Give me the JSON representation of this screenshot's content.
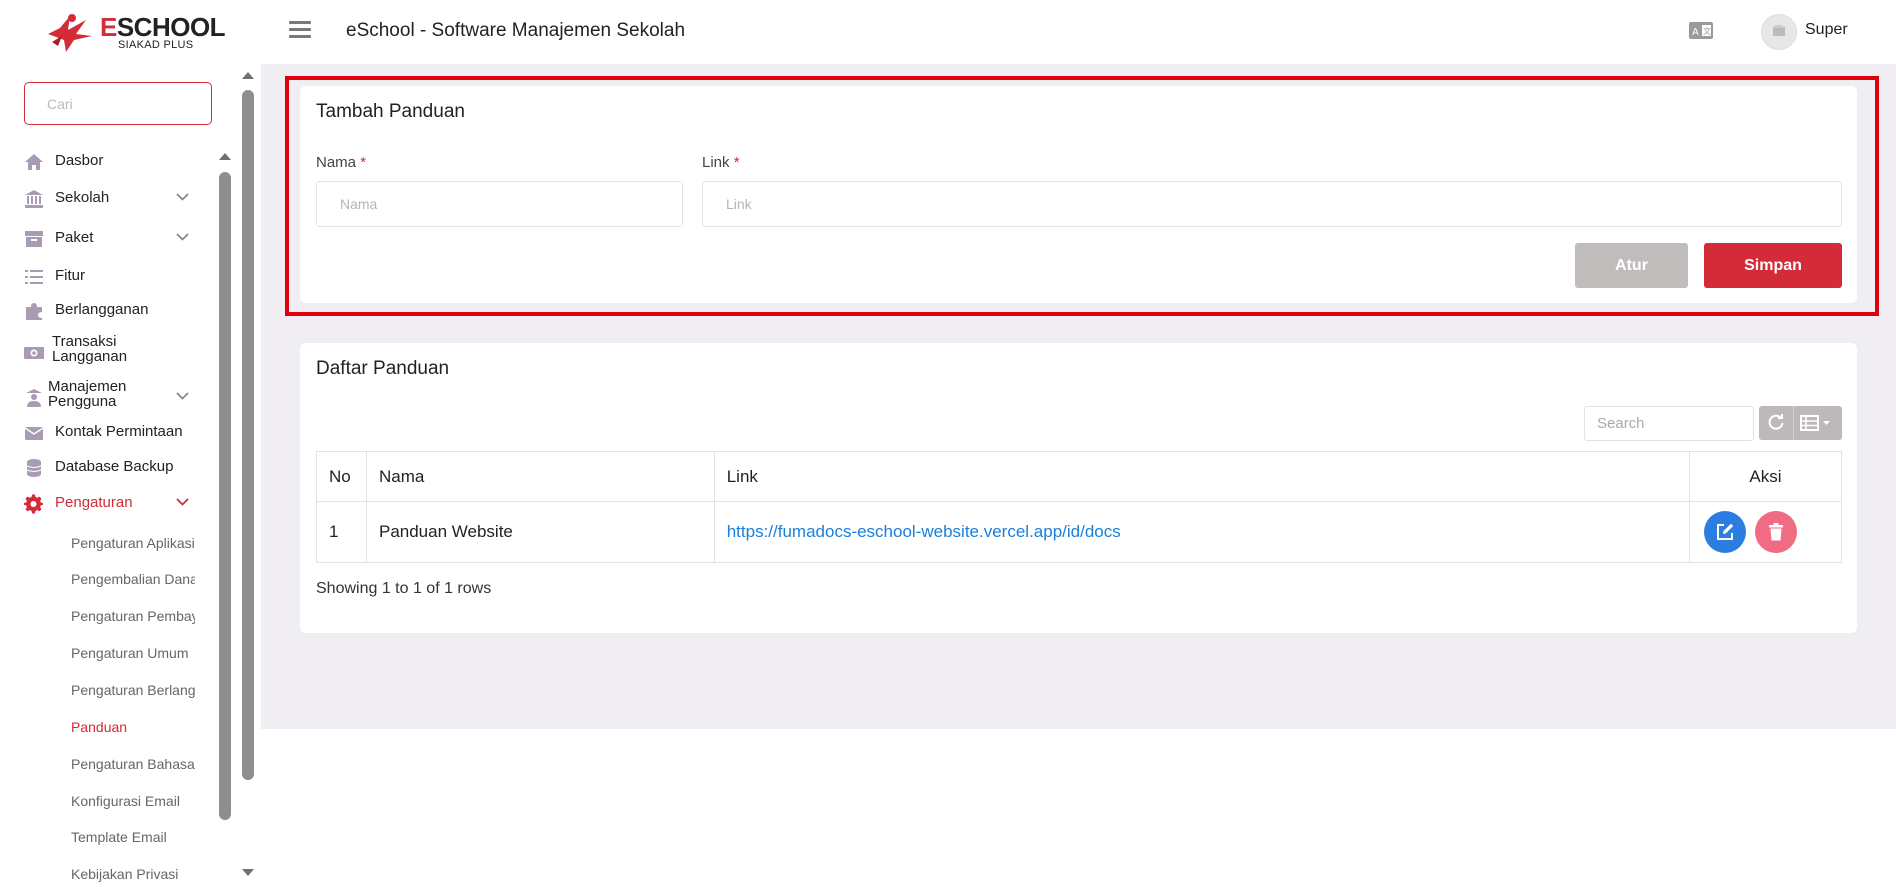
{
  "brand": {
    "name_first": "E",
    "name_rest": "SCHOOL",
    "subtitle": "SIAKAD PLUS"
  },
  "header": {
    "title": "eSchool - Software Manajemen Sekolah",
    "user": "Super"
  },
  "sidebar": {
    "search_placeholder": "Cari",
    "items": [
      {
        "label": "Dasbor",
        "icon": "home-icon"
      },
      {
        "label": "Sekolah",
        "icon": "bank-icon",
        "expandable": true
      },
      {
        "label": "Paket",
        "icon": "archive-icon",
        "expandable": true
      },
      {
        "label": "Fitur",
        "icon": "list-icon"
      },
      {
        "label": "Berlangganan",
        "icon": "puzzle-icon"
      },
      {
        "label": "Transaksi Langganan",
        "icon": "money-icon"
      },
      {
        "label": "Manajemen Pengguna",
        "icon": "users-icon",
        "expandable": true
      },
      {
        "label": "Kontak Permintaan",
        "icon": "envelope-icon"
      },
      {
        "label": "Database Backup",
        "icon": "database-icon"
      },
      {
        "label": "Pengaturan",
        "icon": "gear-icon",
        "expandable": true,
        "active": true
      }
    ],
    "subitems": [
      {
        "label": "Pengaturan Aplikasi"
      },
      {
        "label": "Pengembalian Dana"
      },
      {
        "label": "Pengaturan Pembayaran"
      },
      {
        "label": "Pengaturan Umum"
      },
      {
        "label": "Pengaturan Berlangganan"
      },
      {
        "label": "Panduan",
        "active": true
      },
      {
        "label": "Pengaturan Bahasa"
      },
      {
        "label": "Konfigurasi Email"
      },
      {
        "label": "Template Email"
      },
      {
        "label": "Kebijakan Privasi"
      }
    ]
  },
  "form": {
    "title": "Tambah Panduan",
    "nama_label": "Nama",
    "nama_placeholder": "Nama",
    "link_label": "Link",
    "link_placeholder": "Link",
    "required_mark": "*",
    "reset_button": "Atur",
    "save_button": "Simpan"
  },
  "list": {
    "title": "Daftar Panduan",
    "search_placeholder": "Search",
    "columns": [
      "No",
      "Nama",
      "Link",
      "Aksi"
    ],
    "rows": [
      {
        "no": "1",
        "nama": "Panduan Website",
        "link": "https://fumadocs-eschool-website.vercel.app/id/docs"
      }
    ],
    "pagination": "Showing 1 to 1 of 1 rows"
  },
  "colors": {
    "accent": "#d32b37",
    "highlight": "#e0000c",
    "link": "#1a7fdb",
    "edit": "#2b7ee0",
    "delete": "#f06c83"
  }
}
